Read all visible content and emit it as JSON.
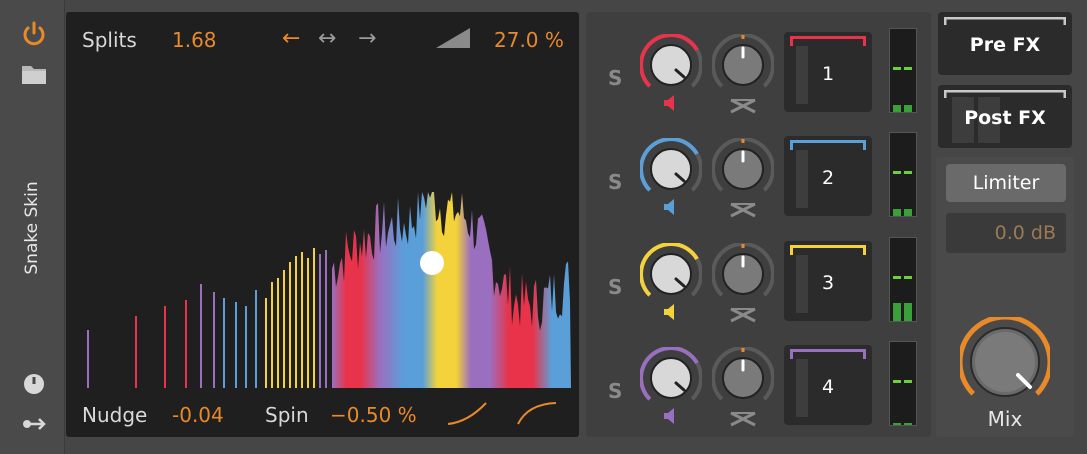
{
  "device": {
    "name": "Snake Skin"
  },
  "colors": {
    "accent": "#e8892a",
    "band1": "#e8334a",
    "band2": "#5b9fd9",
    "band3": "#f3d23b",
    "band4": "#9b6fbf"
  },
  "icons": {
    "power": "power-icon",
    "folder": "folder-icon",
    "clock": "clock-icon",
    "routing": "routing-icon"
  },
  "display": {
    "splits_label": "Splits",
    "splits_value": "1.68",
    "direction_left": "←",
    "direction_both": "↔",
    "direction_right": "→",
    "slope_value": "27.0 %",
    "nudge_label": "Nudge",
    "nudge_value": "-0.04",
    "spin_label": "Spin",
    "spin_value": "−0.50 %"
  },
  "bands": [
    {
      "solo": "S",
      "number": "1",
      "color": "#e8334a",
      "level": 0.08
    },
    {
      "solo": "S",
      "number": "2",
      "color": "#5b9fd9",
      "level": 0.08
    },
    {
      "solo": "S",
      "number": "3",
      "color": "#f3d23b",
      "level": 0.22
    },
    {
      "solo": "S",
      "number": "4",
      "color": "#9b6fbf",
      "level": 0.02
    }
  ],
  "fx": {
    "pre": "Pre FX",
    "post": "Post FX"
  },
  "limiter": {
    "label": "Limiter",
    "value": "0.0 dB"
  },
  "mix": {
    "label": "Mix"
  }
}
